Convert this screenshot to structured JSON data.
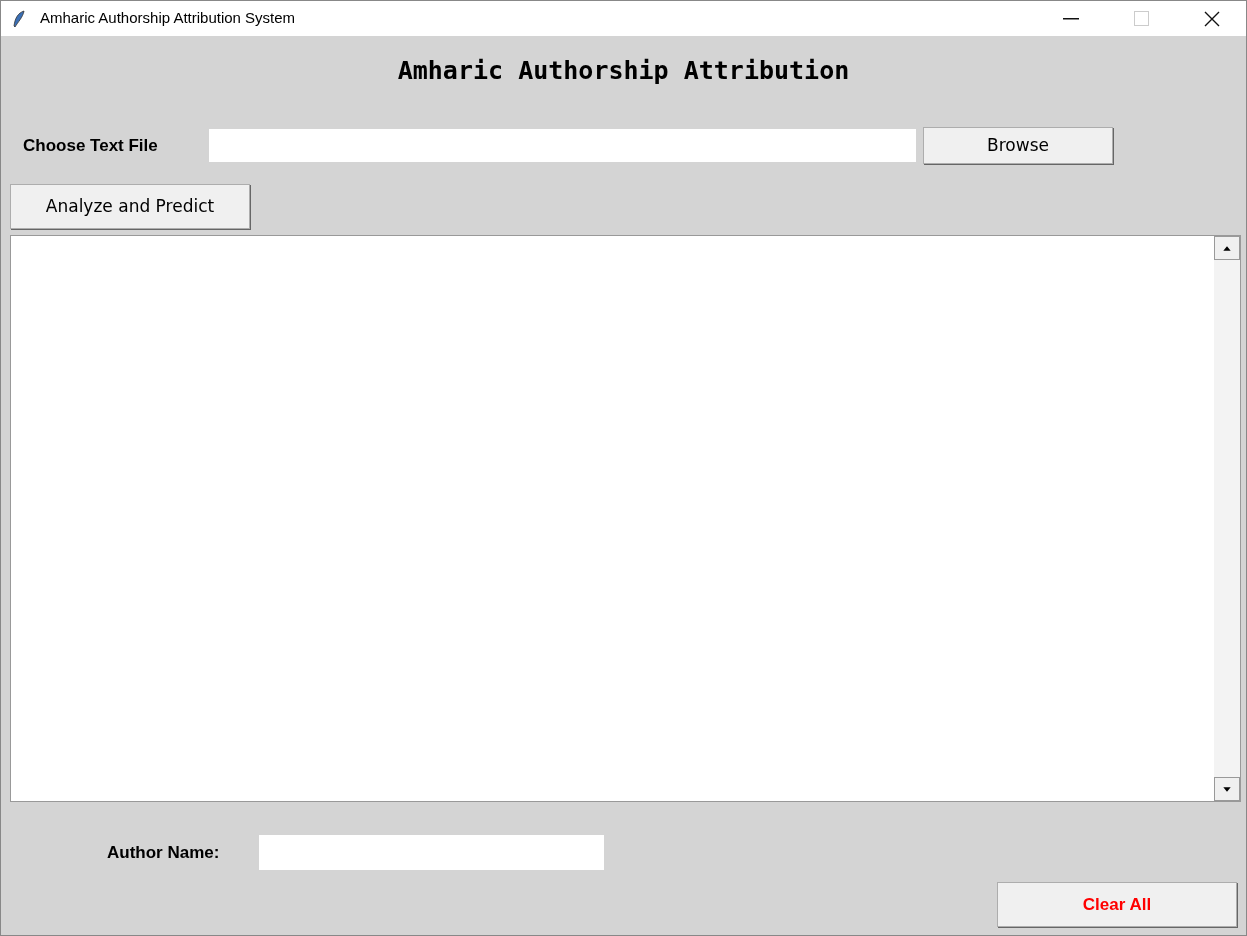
{
  "window": {
    "title": "Amharic Authorship Attribution System"
  },
  "heading": "Amharic Authorship Attribution",
  "file_row": {
    "label": "Choose Text File",
    "button": "Browse"
  },
  "analyze_button": "Analyze and Predict",
  "author_row": {
    "label": "Author Name:"
  },
  "clear_button": "Clear All"
}
